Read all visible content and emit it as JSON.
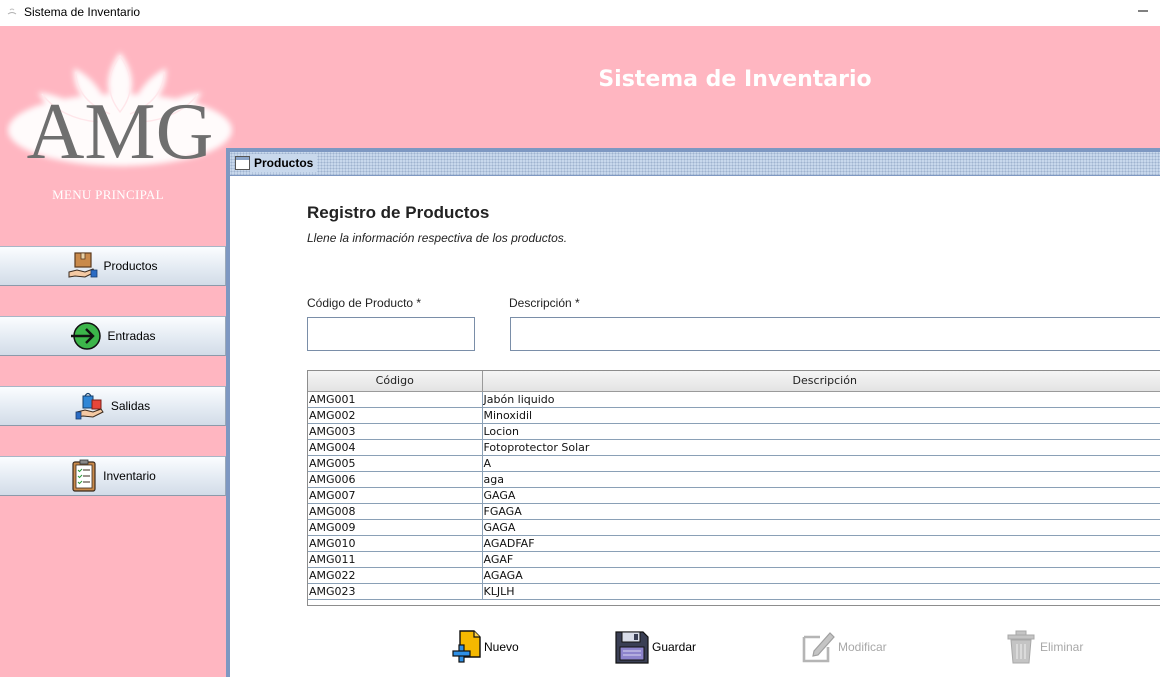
{
  "window": {
    "title": "Sistema de Inventario"
  },
  "header": {
    "title": "Sistema de Inventario"
  },
  "logo": {
    "text": "AMG"
  },
  "sidebar": {
    "title": "MENU PRINCIPAL",
    "items": [
      {
        "label": "Productos",
        "icon": "box-hand-icon"
      },
      {
        "label": "Entradas",
        "icon": "arrow-enter-icon"
      },
      {
        "label": "Salidas",
        "icon": "bag-hand-icon"
      },
      {
        "label": "Inventario",
        "icon": "checklist-icon"
      }
    ]
  },
  "frame": {
    "title": "Productos",
    "heading": "Registro de Productos",
    "subtitle": "Llene la información respectiva de los productos.",
    "fields": {
      "code_label": "Código de Producto *",
      "code_value": "",
      "desc_label": "Descripción *",
      "desc_value": ""
    },
    "table": {
      "columns": [
        "Código",
        "Descripción"
      ],
      "rows": [
        [
          "AMG001",
          "Jabón liquido"
        ],
        [
          "AMG002",
          "Minoxidil"
        ],
        [
          "AMG003",
          "Locion"
        ],
        [
          "AMG004",
          "Fotoprotector Solar"
        ],
        [
          "AMG005",
          "A"
        ],
        [
          "AMG006",
          "aga"
        ],
        [
          "AMG007",
          "GAGA"
        ],
        [
          "AMG008",
          "FGAGA"
        ],
        [
          "AMG009",
          "GAGA"
        ],
        [
          "AMG010",
          "AGADFAF"
        ],
        [
          "AMG011",
          "AGAF"
        ],
        [
          "AMG022",
          "AGAGA"
        ],
        [
          "AMG023",
          "KLJLH"
        ]
      ]
    },
    "actions": {
      "new_label": "Nuevo",
      "save_label": "Guardar",
      "edit_label": "Modificar",
      "delete_label": "Eliminar"
    }
  },
  "colors": {
    "background": "#ffb6c1",
    "frame_border": "#7e98c2",
    "header_text": "#ffffff"
  }
}
